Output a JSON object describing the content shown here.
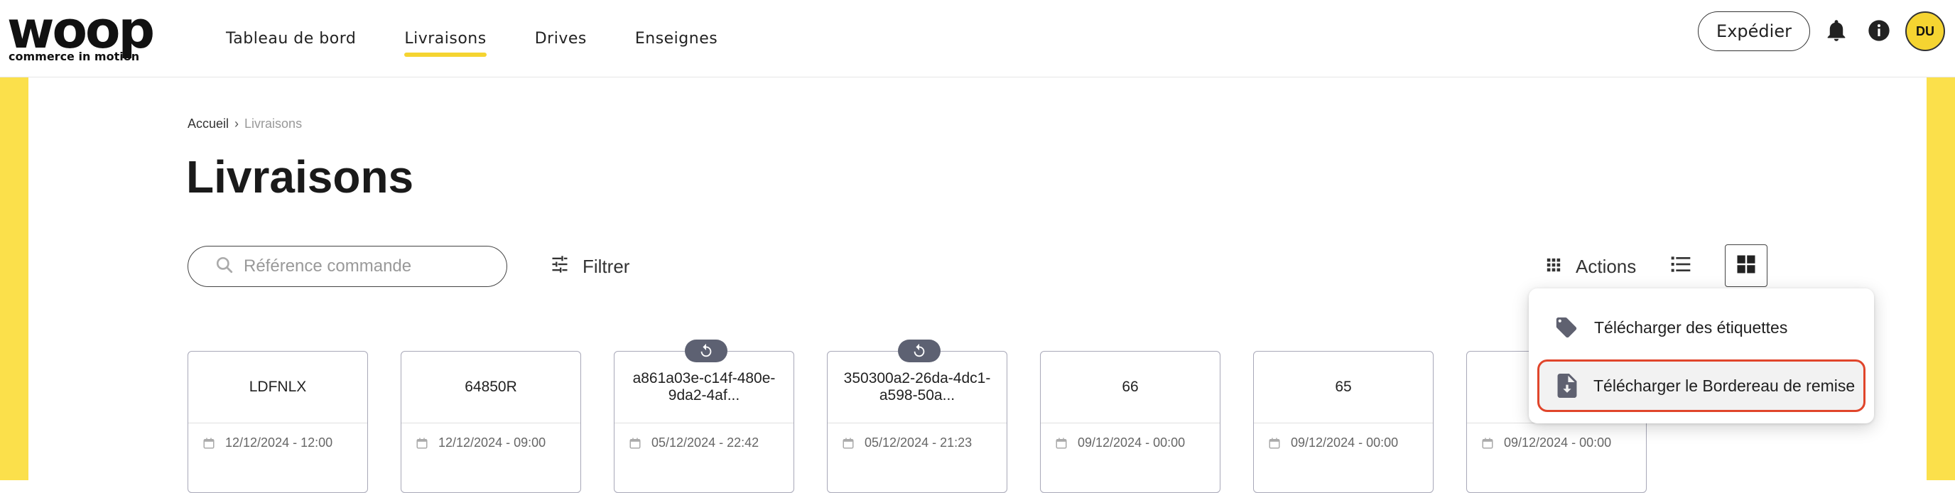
{
  "brand": {
    "logo_word": "woop",
    "logo_tagline": "commerce in motion"
  },
  "nav": {
    "items": [
      {
        "label": "Tableau de bord"
      },
      {
        "label": "Livraisons"
      },
      {
        "label": "Drives"
      },
      {
        "label": "Enseignes"
      }
    ],
    "active": "Livraisons"
  },
  "header": {
    "expedier_label": "Expédier",
    "avatar_initials": "DU",
    "icons": [
      "bell-icon",
      "info-icon"
    ]
  },
  "breadcrumb": {
    "home": "Accueil",
    "current": "Livraisons"
  },
  "page": {
    "title": "Livraisons"
  },
  "search": {
    "placeholder": "Référence commande",
    "value": ""
  },
  "toolbar": {
    "filter_label": "Filtrer",
    "actions_label": "Actions",
    "view_mode": "grid"
  },
  "dropdown": {
    "items": [
      {
        "label": "Télécharger des étiquettes",
        "icon": "tag-icon"
      },
      {
        "label": "Télécharger le Bordereau de remise",
        "icon": "file-download-icon"
      }
    ]
  },
  "cards": [
    {
      "reference": "LDFNLX",
      "datetime": "12/12/2024 - 12:00",
      "badge": false
    },
    {
      "reference": "64850R",
      "datetime": "12/12/2024 - 09:00",
      "badge": false
    },
    {
      "reference": "a861a03e-c14f-480e-9da2-4af...",
      "datetime": "05/12/2024 - 22:42",
      "badge": true
    },
    {
      "reference": "350300a2-26da-4dc1-a598-50a...",
      "datetime": "05/12/2024 - 21:23",
      "badge": true
    },
    {
      "reference": "66",
      "datetime": "09/12/2024 - 00:00",
      "badge": false
    },
    {
      "reference": "65",
      "datetime": "09/12/2024 - 00:00",
      "badge": false
    },
    {
      "reference": "",
      "datetime": "09/12/2024 - 00:00",
      "badge": false
    }
  ],
  "colors": {
    "accent_yellow": "#fbe04b",
    "badge_gray": "#5d6172",
    "highlight_red": "#e0452b"
  }
}
